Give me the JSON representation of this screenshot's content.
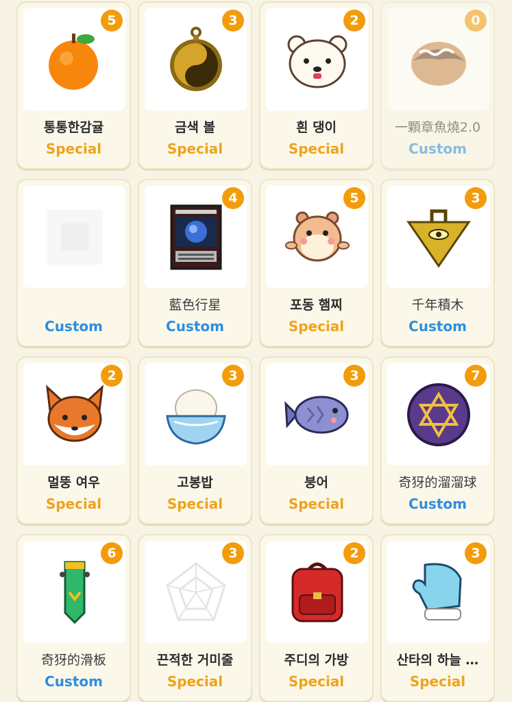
{
  "colors": {
    "special": "#f0a21a",
    "custom": "#2e8ee0",
    "badge": "#f39c0b"
  },
  "items": [
    {
      "name": "통통한감귤",
      "type": "Special",
      "count": "5",
      "icon": "tangerine-icon"
    },
    {
      "name": "금색 볼",
      "type": "Special",
      "count": "3",
      "icon": "golden-yin-yang-ball-icon"
    },
    {
      "name": "흰 댕이",
      "type": "Special",
      "count": "2",
      "icon": "white-puppy-icon"
    },
    {
      "name": "一顆章魚燒2.0",
      "type": "Custom",
      "count": "0",
      "icon": "takoyaki-icon"
    },
    {
      "name": "",
      "type": "Custom",
      "count": "",
      "icon": "blurred-image-icon"
    },
    {
      "name": "藍色行星",
      "type": "Custom",
      "count": "4",
      "icon": "blue-planet-screen-icon"
    },
    {
      "name": "포동 햄찌",
      "type": "Special",
      "count": "5",
      "icon": "hamster-icon"
    },
    {
      "name": "千年積木",
      "type": "Custom",
      "count": "3",
      "icon": "millennium-puzzle-icon"
    },
    {
      "name": "멀뚱 여우",
      "type": "Special",
      "count": "2",
      "icon": "fox-icon"
    },
    {
      "name": "고봉밥",
      "type": "Special",
      "count": "3",
      "icon": "rice-bowl-icon"
    },
    {
      "name": "붕어",
      "type": "Special",
      "count": "3",
      "icon": "fish-bread-icon"
    },
    {
      "name": "奇犽的溜溜球",
      "type": "Custom",
      "count": "7",
      "icon": "hexagram-yoyo-icon"
    },
    {
      "name": "奇犽的滑板",
      "type": "Custom",
      "count": "6",
      "icon": "skateboard-icon"
    },
    {
      "name": "끈적한 거미줄",
      "type": "Special",
      "count": "3",
      "icon": "spider-web-icon"
    },
    {
      "name": "주디의 가방",
      "type": "Special",
      "count": "2",
      "icon": "red-backpack-icon"
    },
    {
      "name": "산타의 하늘 …",
      "type": "Special",
      "count": "3",
      "icon": "mitten-icon"
    }
  ]
}
